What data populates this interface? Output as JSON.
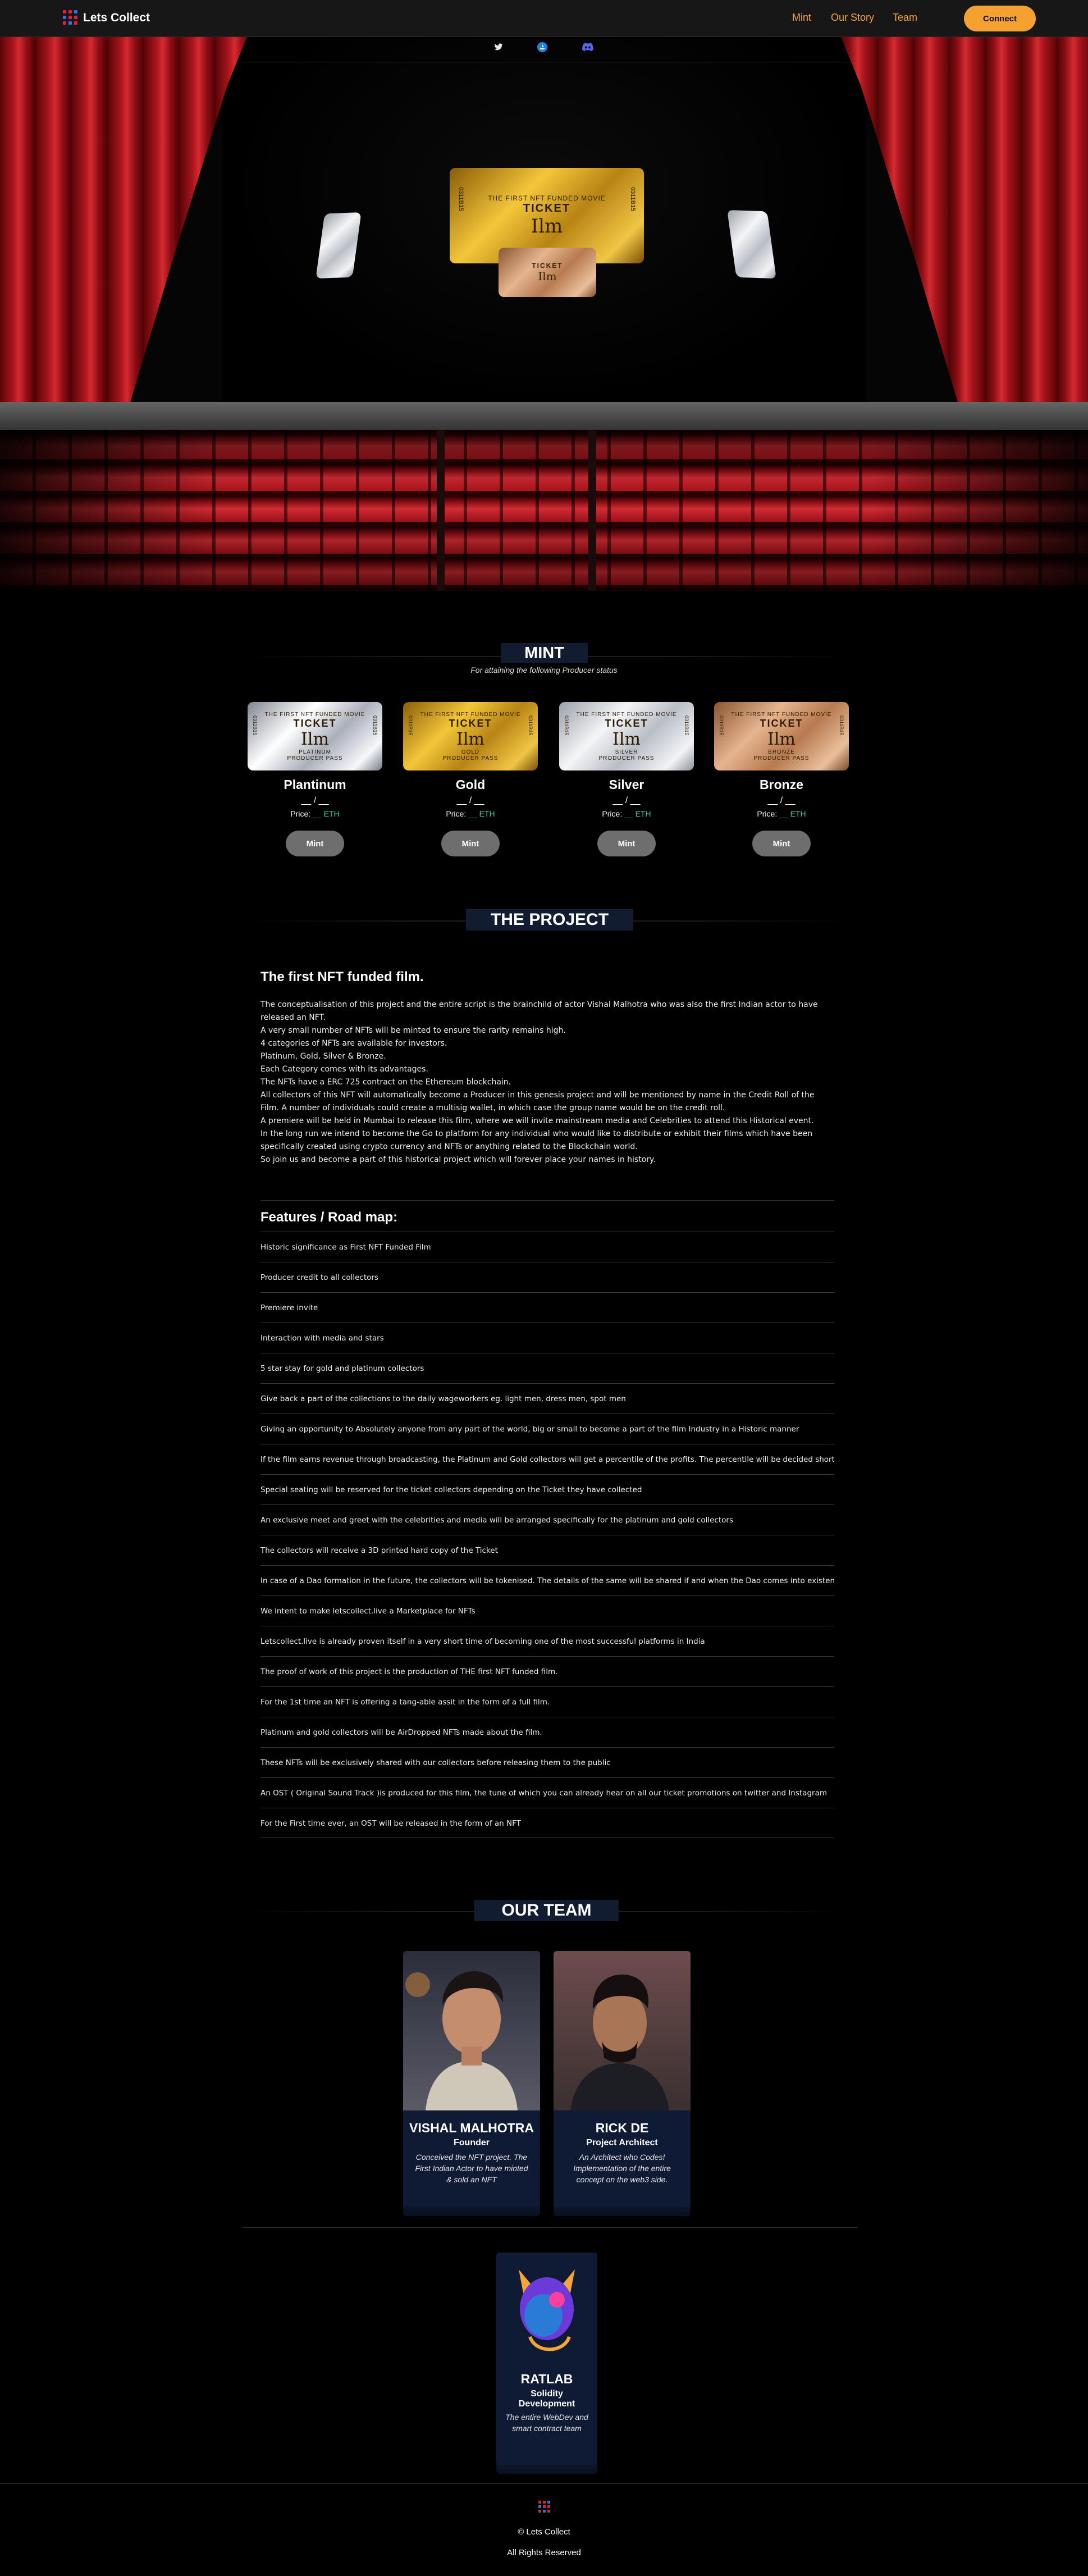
{
  "nav": {
    "brand": "Lets Collect",
    "links": [
      "Mint",
      "Our Story",
      "Team"
    ],
    "connect": "Connect"
  },
  "hero": {
    "social_icons": [
      "twitter-icon",
      "opensea-icon",
      "discord-icon"
    ],
    "ticket": {
      "top_line": "THE FIRST NFT FUNDED MOVIE",
      "title": "TICKET",
      "name": "Ilm",
      "serial": "0311B15"
    }
  },
  "mint": {
    "title": "MINT",
    "subtitle": "For attaining the following Producer status",
    "ticket_top": "THE FIRST NFT FUNDED MOVIE",
    "ticket_title": "TICKET",
    "ticket_name": "Ilm",
    "ticket_serial": "0311B15",
    "price_label": "Price:",
    "price_value": "__",
    "currency": "ETH",
    "qty": "__ / __",
    "button": "Mint",
    "tiers": [
      {
        "name": "Plantinum",
        "pass": "PLATINUM\nPRODUCER PASS",
        "style": "t-plat"
      },
      {
        "name": "Gold",
        "pass": "GOLD\nPRODUCER PASS",
        "style": "t-gold"
      },
      {
        "name": "Silver",
        "pass": "SILVER\nPRODUCER PASS",
        "style": "t-silver"
      },
      {
        "name": "Bronze",
        "pass": "BRONZE\nPRODUCER PASS",
        "style": "t-bronze"
      }
    ]
  },
  "project": {
    "title": "THE PROJECT",
    "heading": "The first NFT funded film.",
    "paragraphs": [
      "The conceptualisation of this project and the entire script is the brainchild of actor Vishal Malhotra who was also the first Indian actor to have released an NFT.",
      "A very small number of NFTs will be minted to ensure the rarity remains high.",
      "4 categories of NFTs are available for investors.",
      "Platinum, Gold, Silver & Bronze.",
      "Each Category comes with its advantages.",
      "The NFTs have a ERC 725 contract on the Ethereum blockchain.",
      "All collectors of this NFT will automatically become a Producer in this genesis project and will be mentioned by name in the Credit Roll of the Film. A number of individuals could create a multisig wallet, in which case the group name would be on the credit roll.",
      "A premiere will be held in Mumbai to release this film, where we will invite mainstream media and Celebrities to attend this Historical event.",
      "In the long run we intend to become the Go to platform for any individual who would like to distribute or exhibit their films which have been specifically created using crypto currency and NFTs or anything related to the Blockchain world.",
      "So join us and become a part of this historical project which will forever place your names in history."
    ],
    "features_heading": "Features / Road map:",
    "features": [
      "Historic significance as First NFT Funded Film",
      "Producer credit to all collectors",
      "Premiere invite",
      "Interaction with media and stars",
      "5 star stay for gold and platinum collectors",
      "Give back a part of the collections to the daily wageworkers eg. light men, dress men, spot men",
      "Giving an opportunity to Absolutely anyone from any part of the world, big or small to become a part of the film Industry in a Historic manner",
      "If the film earns revenue through broadcasting, the Platinum and Gold collectors will get a percentile of the profits. The percentile will be decided shortly.",
      "Special seating will be reserved for the ticket collectors depending on the Ticket they have collected",
      "An exclusive meet and greet with the celebrities and media will be arranged specifically for the platinum and gold collectors",
      "The collectors will receive a 3D printed hard copy of the Ticket",
      "In case of a Dao formation in the future, the collectors will be tokenised. The details of the same will be shared if and when the Dao comes into existence",
      "We intent to make letscollect.live a Marketplace for NFTs",
      "Letscollect.live is already proven itself in a very short time of becoming one of the most successful platforms in India",
      "The proof of work of this project is the production of THE first NFT funded film.",
      "For the 1st time an NFT is offering a tang-able assit in the form of a full film.",
      "Platinum and gold collectors will be AirDropped NFTs made about the film.",
      "These NFTs will be exclusively shared with our collectors before releasing them to the public",
      "An OST ( Original Sound Track )is produced for this film, the tune of which you can already hear on all our ticket promotions on twitter and Instagram",
      "For the First time ever, an OST will be released in the form of an NFT"
    ]
  },
  "team": {
    "title": "OUR TEAM",
    "members": [
      {
        "name": "VISHAL MALHOTRA",
        "role": "Founder",
        "desc": "Conceived the NFT project. The First Indian Actor to have minted & sold an NFT"
      },
      {
        "name": "RICK DE",
        "role": "Project Architect",
        "desc": "An Architect who Codes! Implementation of the entire concept on the web3 side."
      },
      {
        "name": "RATLAB",
        "role": "Solidity Development",
        "desc": "The entire WebDev and smart contract team"
      }
    ]
  },
  "footer": {
    "copyright": "© Lets Collect",
    "rights": "All Rights Reserved"
  },
  "colors": {
    "accent": "#f5a132",
    "nav_link": "#f7a13a",
    "card_bg": "#0f1a35",
    "eth": "#2bd3a0"
  }
}
